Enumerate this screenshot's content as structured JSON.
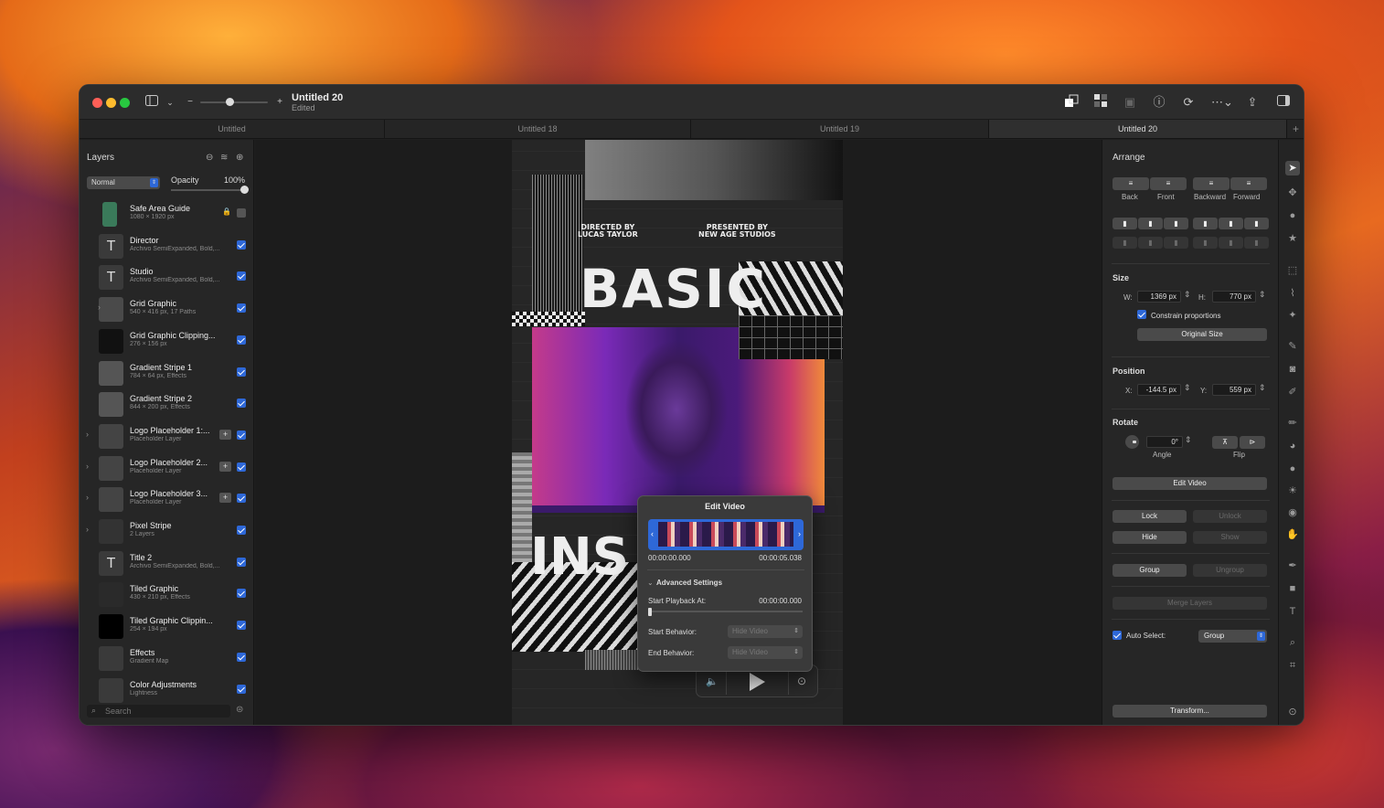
{
  "window": {
    "title": "Untitled 20",
    "subtitle": "Edited"
  },
  "tabs": [
    "Untitled",
    "Untitled 18",
    "Untitled 19",
    "Untitled 20"
  ],
  "layers_panel": {
    "title": "Layers",
    "blend_mode": "Normal",
    "opacity_label": "Opacity",
    "opacity_value": "100%",
    "search_placeholder": "Search"
  },
  "layers": [
    {
      "name": "Safe Area Guide",
      "sub": "1080 × 1920 px"
    },
    {
      "name": "Director",
      "sub": "Archivo SemiExpanded, Bold,..."
    },
    {
      "name": "Studio",
      "sub": "Archivo SemiExpanded, Bold,..."
    },
    {
      "name": "Grid Graphic",
      "sub": "540 × 416 px, 17 Paths"
    },
    {
      "name": "Grid Graphic Clipping...",
      "sub": "276 × 156 px"
    },
    {
      "name": "Gradient Stripe 1",
      "sub": "784 × 64 px, Effects"
    },
    {
      "name": "Gradient Stripe 2",
      "sub": "844 × 200 px, Effects"
    },
    {
      "name": "Logo Placeholder 1:...",
      "sub": "Placeholder Layer"
    },
    {
      "name": "Logo Placeholder 2...",
      "sub": "Placeholder Layer"
    },
    {
      "name": "Logo Placeholder 3...",
      "sub": "Placeholder Layer"
    },
    {
      "name": "Pixel Stripe",
      "sub": "2 Layers"
    },
    {
      "name": "Title 2",
      "sub": "Archivo SemiExpanded, Bold,..."
    },
    {
      "name": "Tiled Graphic",
      "sub": "430 × 210 px, Effects"
    },
    {
      "name": "Tiled Graphic Clippin...",
      "sub": "254 × 194 px"
    },
    {
      "name": "Effects",
      "sub": "Gradient Map"
    },
    {
      "name": "Color Adjustments",
      "sub": "Lightness"
    }
  ],
  "poster": {
    "director_line1": "DIRECTED BY",
    "director_line2": "LUCAS TAYLOR",
    "studio_line1": "PRESENTED BY",
    "studio_line2": "NEW AGE STUDIOS",
    "title": "BASIC",
    "title2": "INS"
  },
  "edit_video": {
    "title": "Edit Video",
    "start_time": "00:00:00.000",
    "end_time": "00:00:05.038",
    "advanced": "Advanced Settings",
    "start_playback_label": "Start Playback At:",
    "start_playback_value": "00:00:00.000",
    "start_behavior_label": "Start Behavior:",
    "start_behavior_value": "Hide Video",
    "end_behavior_label": "End Behavior:",
    "end_behavior_value": "Hide Video"
  },
  "arrange": {
    "title": "Arrange",
    "back": "Back",
    "front": "Front",
    "backward": "Backward",
    "forward": "Forward",
    "size_title": "Size",
    "w_label": "W:",
    "w_value": "1369 px",
    "h_label": "H:",
    "h_value": "770 px",
    "constrain": "Constrain proportions",
    "original_size": "Original Size",
    "position_title": "Position",
    "x_label": "X:",
    "x_value": "-144.5 px",
    "y_label": "Y:",
    "y_value": "559 px",
    "rotate_title": "Rotate",
    "angle_value": "0°",
    "angle_label": "Angle",
    "flip_label": "Flip",
    "edit_video": "Edit Video",
    "lock": "Lock",
    "unlock": "Unlock",
    "hide": "Hide",
    "show": "Show",
    "group": "Group",
    "ungroup": "Ungroup",
    "merge": "Merge Layers",
    "auto_select": "Auto Select:",
    "auto_select_value": "Group",
    "transform": "Transform..."
  }
}
